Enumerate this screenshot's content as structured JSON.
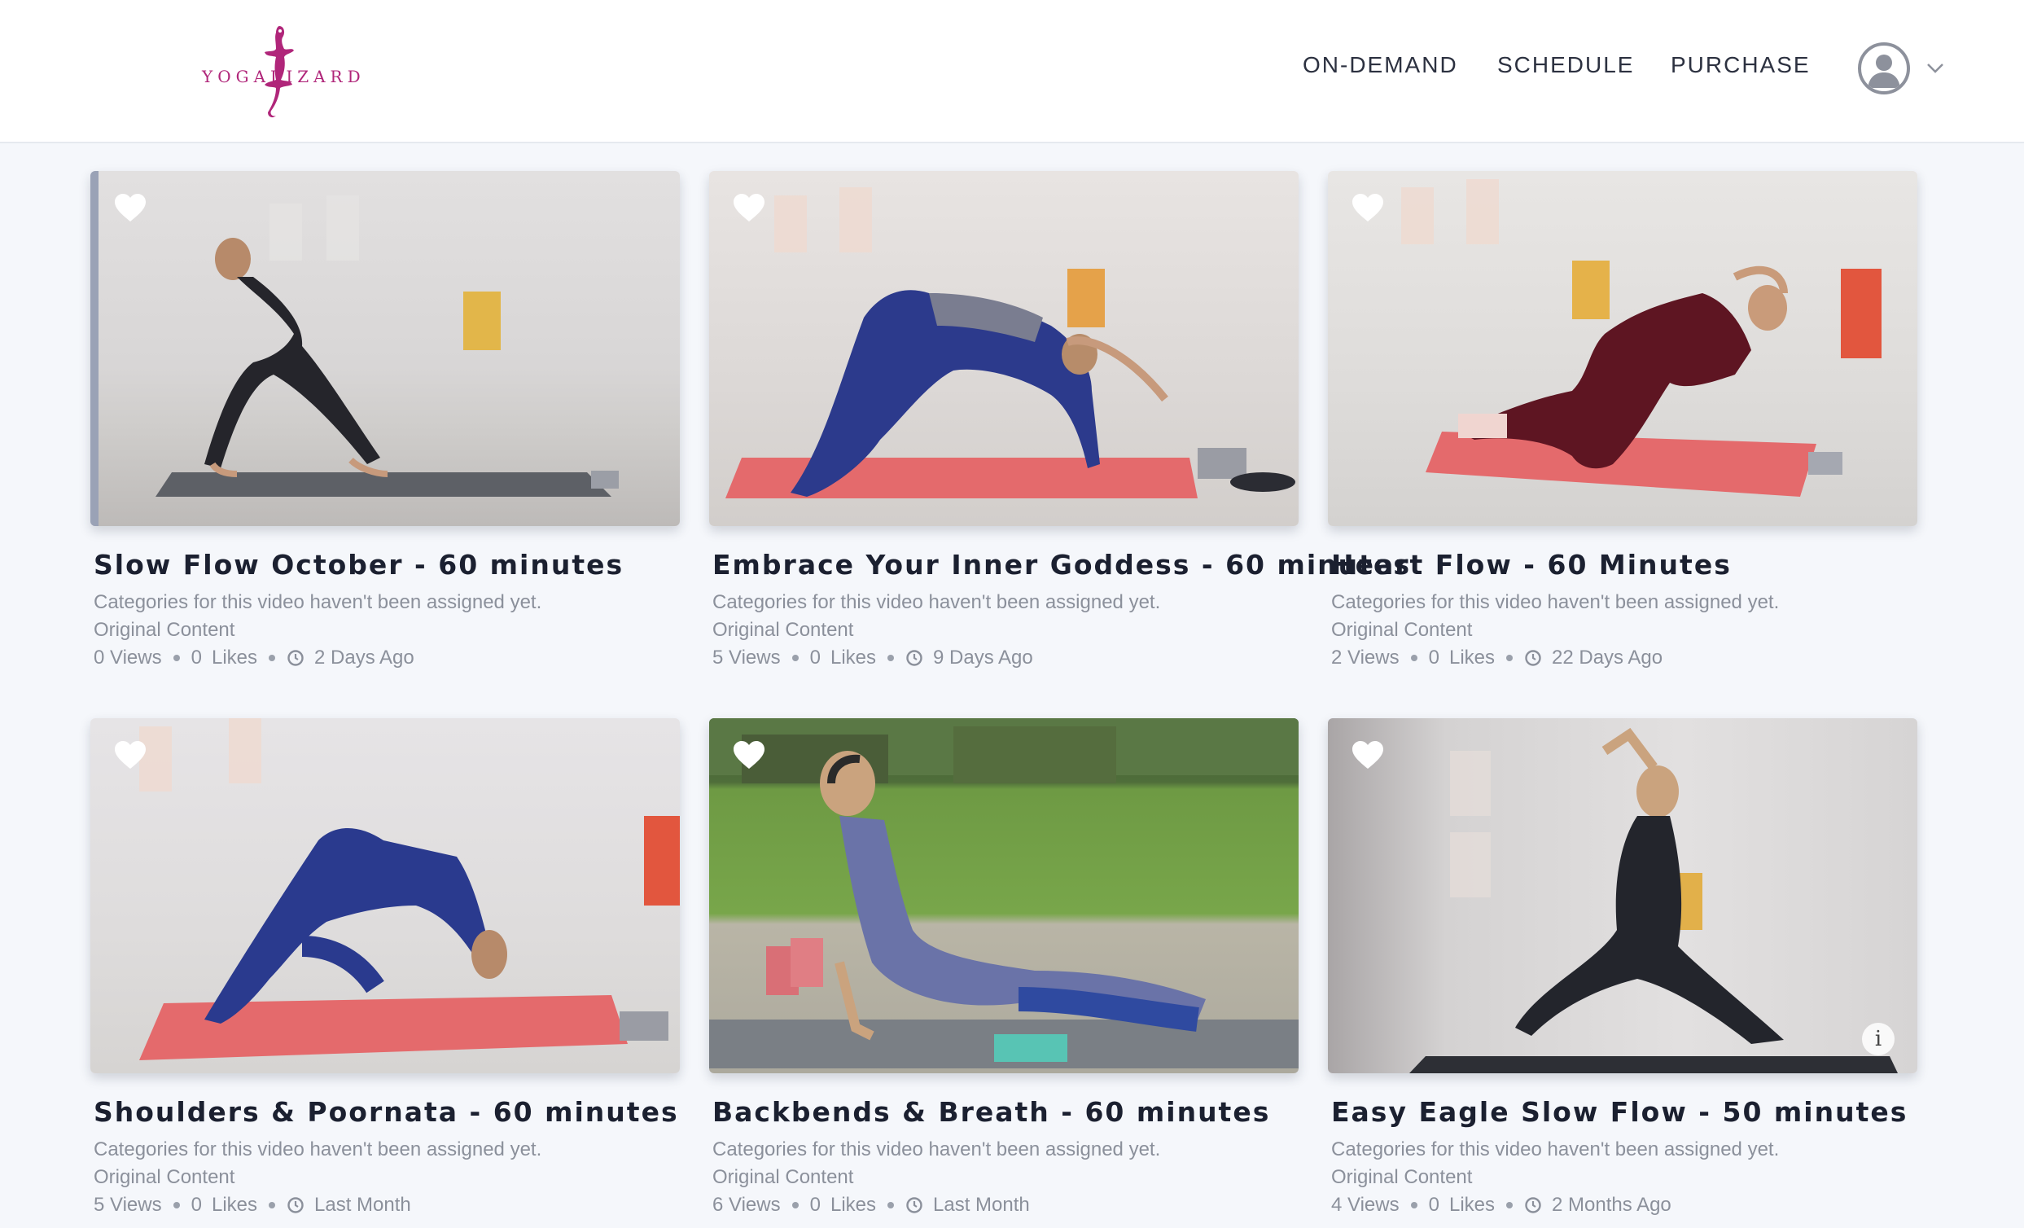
{
  "brand": {
    "logo_text_left": "YOGA",
    "logo_text_right": "LIZARD",
    "logo_color": "#b0267a"
  },
  "nav": {
    "on_demand": "ON-DEMAND",
    "schedule": "SCHEDULE",
    "purchase": "PURCHASE"
  },
  "icons": {
    "favorite": "heart-icon",
    "profile": "user-avatar-icon",
    "menu": "chevron-down-icon",
    "time": "clock-icon",
    "info": "info-icon"
  },
  "videos": [
    {
      "title": "Slow Flow October - 60 minutes",
      "categories": "Categories for this video haven't been assigned yet.",
      "source": "Original Content",
      "views": "0 Views",
      "likes_count": "0",
      "likes_label": "Likes",
      "age": "2 Days Ago"
    },
    {
      "title": "Embrace Your Inner Goddess - 60 minutes",
      "categories": "Categories for this video haven't been assigned yet.",
      "source": "Original Content",
      "views": "5 Views",
      "likes_count": "0",
      "likes_label": "Likes",
      "age": "9 Days Ago"
    },
    {
      "title": "Heart Flow - 60 Minutes",
      "categories": "Categories for this video haven't been assigned yet.",
      "source": "Original Content",
      "views": "2 Views",
      "likes_count": "0",
      "likes_label": "Likes",
      "age": "22 Days Ago"
    },
    {
      "title": "Shoulders & Poornata - 60 minutes",
      "categories": "Categories for this video haven't been assigned yet.",
      "source": "Original Content",
      "views": "5 Views",
      "likes_count": "0",
      "likes_label": "Likes",
      "age": "Last Month"
    },
    {
      "title": "Backbends & Breath - 60 minutes",
      "categories": "Categories for this video haven't been assigned yet.",
      "source": "Original Content",
      "views": "6 Views",
      "likes_count": "0",
      "likes_label": "Likes",
      "age": "Last Month"
    },
    {
      "title": "Easy Eagle Slow Flow - 50 minutes",
      "categories": "Categories for this video haven't been assigned yet.",
      "source": "Original Content",
      "views": "4 Views",
      "likes_count": "0",
      "likes_label": "Likes",
      "age": "2 Months Ago",
      "info_glyph": "i"
    }
  ]
}
